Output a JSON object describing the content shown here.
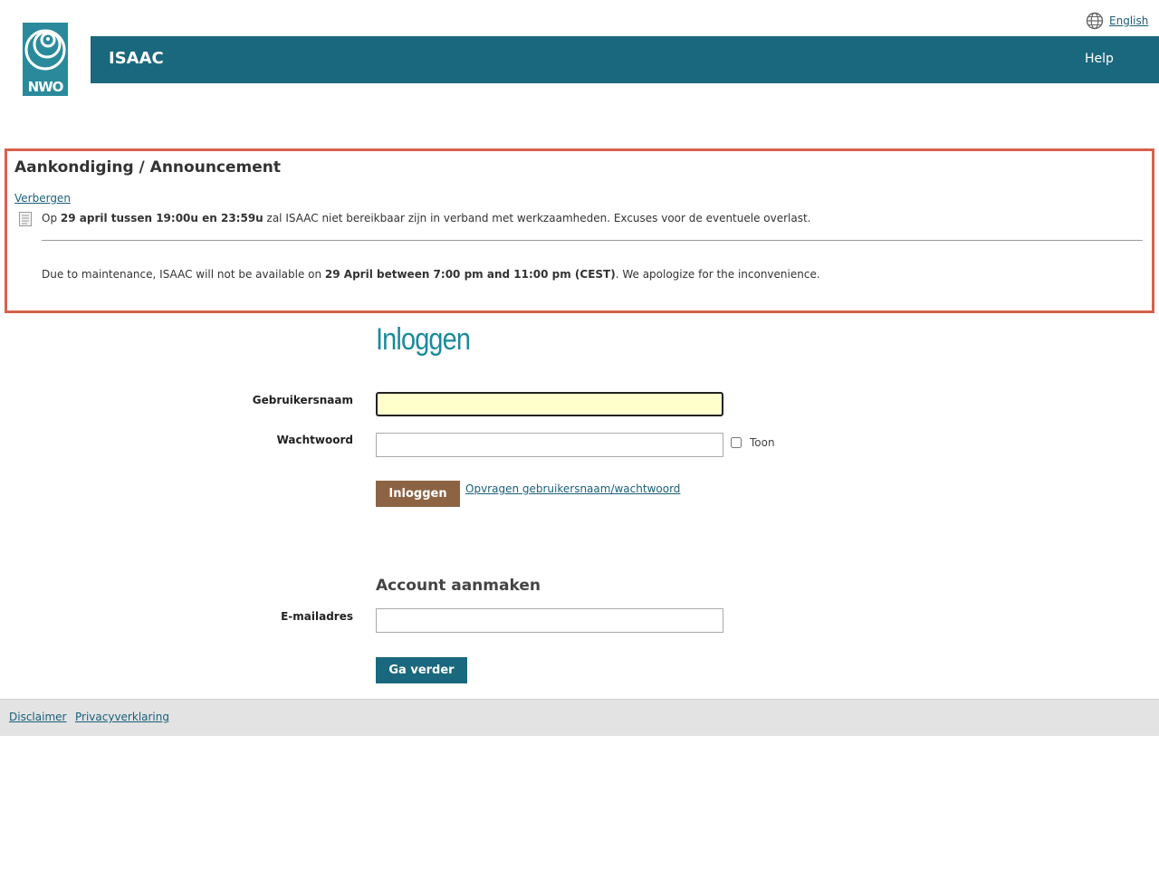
{
  "top": {
    "language_label": "English"
  },
  "logo": {
    "text": "NWO"
  },
  "header": {
    "title": "ISAAC",
    "help_label": "Help"
  },
  "announcement": {
    "title": "Aankondiging / Announcement",
    "hide_label": "Verbergen",
    "nl": {
      "pre": "Op ",
      "bold": "29 april tussen 19:00u en 23:59u",
      "post": " zal ISAAC niet bereikbaar zijn in verband met werkzaamheden. Excuses voor de eventuele overlast."
    },
    "en": {
      "pre": "Due to maintenance, ISAAC will not be available on ",
      "bold": "29 April between 7:00 pm and 11:00 pm (CEST)",
      "post": ". We apologize for the inconvenience."
    }
  },
  "login": {
    "title": "Inloggen",
    "username_label": "Gebruikersnaam",
    "username_value": "",
    "password_label": "Wachtwoord",
    "password_value": "",
    "show_label": "Toon",
    "submit_label": "Inloggen",
    "forgot_label": "Opvragen gebruikersnaam/wachtwoord"
  },
  "account": {
    "title": "Account aanmaken",
    "email_label": "E-mailadres",
    "email_value": "",
    "continue_label": "Ga verder"
  },
  "footer": {
    "disclaimer": "Disclaimer",
    "privacy": "Privacyverklaring"
  },
  "colors": {
    "header": "#1a687e",
    "accent_title": "#1a8a9c",
    "announcement_border": "#d9604b",
    "login_button": "#8c6443",
    "link": "#1a5f7a"
  }
}
